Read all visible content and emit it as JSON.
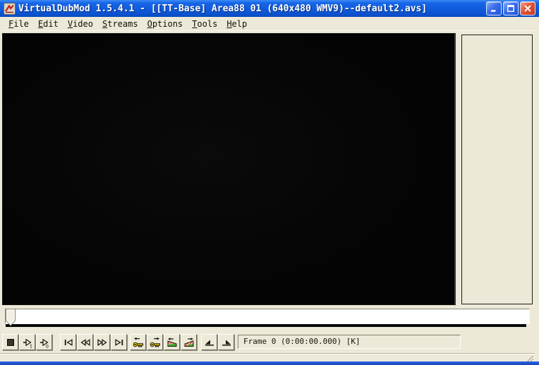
{
  "window": {
    "title": "VirtualDubMod 1.5.4.1 - [[TT-Base] Area88 01 (640x480 WMV9)--default2.avs]",
    "app_icon": "virtualdubmod-logo",
    "controls": [
      {
        "name": "minimize"
      },
      {
        "name": "maximize"
      },
      {
        "name": "close"
      }
    ]
  },
  "menu_bar": {
    "items": [
      {
        "label": "File",
        "mnemonic": 0
      },
      {
        "label": "Edit",
        "mnemonic": 0
      },
      {
        "label": "Video",
        "mnemonic": 0
      },
      {
        "label": "Streams",
        "mnemonic": 0
      },
      {
        "label": "Options",
        "mnemonic": 0
      },
      {
        "label": "Tools",
        "mnemonic": 0
      },
      {
        "label": "Help",
        "mnemonic": 0
      }
    ]
  },
  "panes": {
    "input_pane": "black video frame",
    "output_pane": "empty"
  },
  "seek_bar": {
    "thumb_frame": 0
  },
  "toolbar": {
    "groups": [
      {
        "buttons": [
          "stop",
          "play-input",
          "play-output"
        ]
      },
      {
        "buttons": [
          "goto-start",
          "frame-back",
          "frame-forward",
          "goto-end"
        ]
      },
      {
        "buttons": [
          "key-previous",
          "key-next",
          "scene-reverse",
          "scene-forward"
        ]
      },
      {
        "buttons": [
          "mark-in",
          "mark-out"
        ]
      }
    ]
  },
  "status_bar": {
    "frame_info": "Frame 0 (0:00:00.000) [K]"
  },
  "colors": {
    "titlebar_blue": "#0f5ada",
    "window_border_blue": "#1c50d8",
    "client_bg": "#ece9d8",
    "video_black": "#050505",
    "key_yellow": "#ffdf00",
    "scene_red": "#e23c1e",
    "scene_green": "#2eb82a",
    "close_button_red": "#e25537"
  }
}
